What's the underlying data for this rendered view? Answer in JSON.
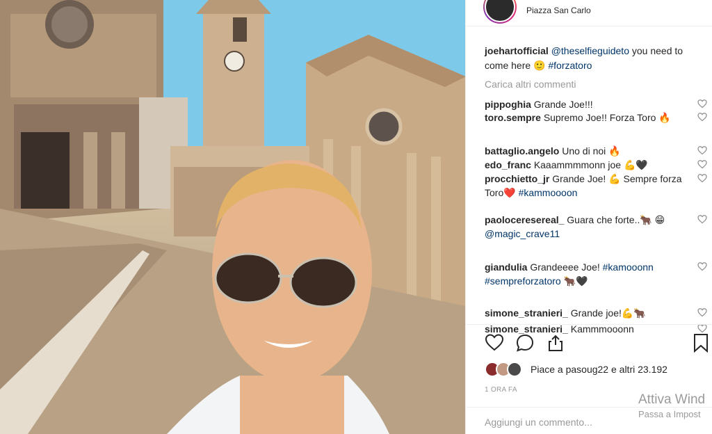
{
  "post": {
    "location": "Piazza San Carlo",
    "caption": {
      "user": "joehartofficial",
      "mention": "@theselfieguideto",
      "text": " you need to come here 🙂 ",
      "hashtag": "#forzatoro"
    },
    "load_more": "Carica altri commenti",
    "comments": [
      {
        "user": "pippoghia",
        "parts": [
          {
            "t": "Grande Joe!!!",
            "k": "text"
          }
        ]
      },
      {
        "user": "toro.sempre",
        "parts": [
          {
            "t": "Supremo Joe!! Forza Toro 🔥",
            "k": "text"
          }
        ]
      },
      {
        "user": "battaglio.angelo",
        "parts": [
          {
            "t": "Uno di noi 🔥",
            "k": "text"
          }
        ]
      },
      {
        "user": "edo_franc",
        "parts": [
          {
            "t": "Kaaammmmonn joe 💪🖤",
            "k": "text"
          }
        ]
      },
      {
        "user": "procchietto_jr",
        "parts": [
          {
            "t": "Grande Joe! 💪 Sempre forza Toro❤️ ",
            "k": "text"
          },
          {
            "t": "#kammoooon",
            "k": "tag"
          }
        ]
      },
      {
        "user": "paoloceresereal_",
        "parts": [
          {
            "t": "Guara che forte..🐂 😁 ",
            "k": "text"
          },
          {
            "t": "@magic_crave11",
            "k": "tag"
          }
        ]
      },
      {
        "user": "giandulia",
        "parts": [
          {
            "t": "Grandeeee Joe! ",
            "k": "text"
          },
          {
            "t": "#kamooonn #sempreforzatoro",
            "k": "tag"
          },
          {
            "t": " 🐂🖤",
            "k": "text"
          }
        ]
      },
      {
        "user": "simone_stranieri_",
        "parts": [
          {
            "t": "Grande joe!💪🐂",
            "k": "text"
          }
        ]
      },
      {
        "user": "simone_stranieri_",
        "parts": [
          {
            "t": "Kammmooonn",
            "k": "text"
          }
        ]
      }
    ],
    "likes_text": "Piace a pasoug22 e altri 23.192",
    "timestamp": "1 ORA FA",
    "add_comment_placeholder": "Aggiungi un commento..."
  },
  "watermark": {
    "line1": "Attiva Wind",
    "line2": "Passa a Impost"
  },
  "colors": {
    "text": "#262626",
    "link": "#003569",
    "muted": "#999999",
    "border": "#efefef"
  },
  "icons": [
    "heart-icon",
    "comment-icon",
    "share-icon",
    "bookmark-icon"
  ]
}
